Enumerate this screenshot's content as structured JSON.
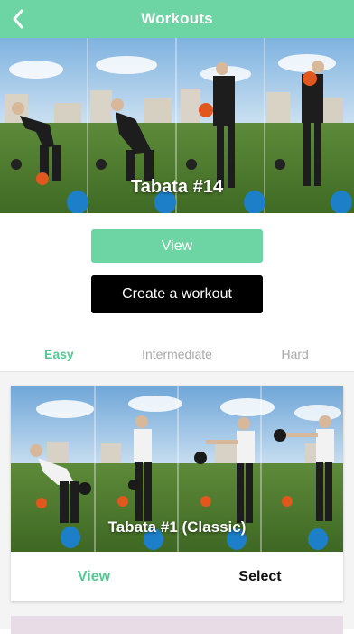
{
  "header": {
    "title": "Workouts",
    "back_icon": "chevron-left-icon"
  },
  "featured": {
    "title": "Tabata #14"
  },
  "actions": {
    "view_label": "View",
    "create_label": "Create a workout"
  },
  "tabs": [
    {
      "label": "Easy",
      "active": true
    },
    {
      "label": "Intermediate",
      "active": false
    },
    {
      "label": "Hard",
      "active": false
    }
  ],
  "workouts": [
    {
      "title": "Tabata #1 (Classic)",
      "view_label": "View",
      "select_label": "Select"
    }
  ],
  "colors": {
    "accent": "#6dd5a3",
    "accent_text": "#55c992",
    "dark_button": "#000000"
  }
}
